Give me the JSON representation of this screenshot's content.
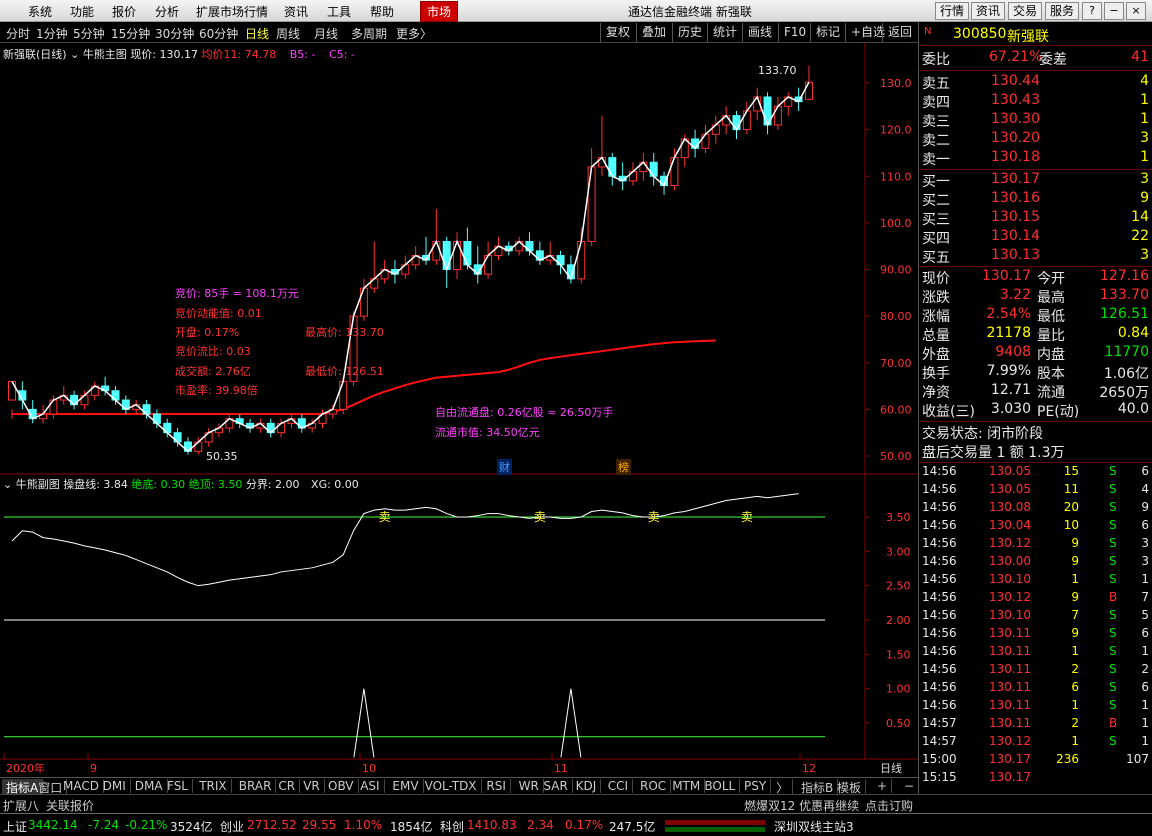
{
  "menu": {
    "items": [
      "系统",
      "功能",
      "报价",
      "分析",
      "扩展市场行情",
      "资讯",
      "工具",
      "帮助"
    ],
    "active": "市场",
    "title": "通达信金融终端 新强联",
    "right_buttons": [
      "行情",
      "资讯",
      "交易",
      "服务"
    ]
  },
  "periods": [
    "分时",
    "1分钟",
    "5分钟",
    "15分钟",
    "30分钟",
    "60分钟",
    "日线",
    "周线",
    "月线",
    "多周期",
    "更多〉"
  ],
  "selected_period": "日线",
  "tools": [
    "复权",
    "叠加",
    "历史",
    "统计",
    "画线",
    "F10",
    "标记",
    "+自选",
    "返回"
  ],
  "main_info": {
    "name": "新强联(日线)",
    "indicator": "牛熊主图",
    "price_label": "现价: 130.17",
    "ma_label": "均价11: 74.78",
    "b5": "B5: -",
    "c5": "C5: -"
  },
  "price_axis": [
    "130.0",
    "120.0",
    "110.0",
    "100.0",
    "90.00",
    "80.00",
    "70.00",
    "60.00",
    "50.00"
  ],
  "high_mark": "133.70",
  "low_mark": "50.35",
  "annotations": {
    "bid_price": "竞价: 85手 = 108.1万元",
    "bid_power": "竞价动能值: 0.01",
    "open": "开盘: 0.17%",
    "bid_ratio": "竞价流比: 0.03",
    "turnover": "成交额: 2.76亿",
    "pe": "市盈率: 39.98倍",
    "high": "最高价: 133.70",
    "low": "最低价: 126.51",
    "free_float": "自由流通盘: 0.26亿股 ≈ 26.50万手",
    "float_cap": "流通市值: 34.50亿元"
  },
  "markers": {
    "cai": "财",
    "bang": "榜"
  },
  "sub_info": {
    "indicator": "牛熊副图",
    "line_label": "操盘线: 3.84",
    "bottom_label": "绝底: 0.30",
    "top_label": "绝顶: 3.50",
    "divide_label": "分界: 2.00",
    "xg_label": "XG: 0.00"
  },
  "sub_axis": [
    "3.50",
    "3.00",
    "2.50",
    "2.00",
    "1.50",
    "1.00",
    "0.50"
  ],
  "sell_label": "卖",
  "x_axis": {
    "labels": [
      "2020年",
      "9",
      "10",
      "11",
      "12"
    ],
    "period": "日线"
  },
  "indicator_tabs": [
    "指标A",
    "窗口",
    "MACD",
    "DMI",
    "DMA",
    "FSL",
    "TRIX",
    "BRAR",
    "CR",
    "VR",
    "OBV",
    "ASI",
    "EMV",
    "VOL-TDX",
    "RSI",
    "WR",
    "SAR",
    "KDJ",
    "CCI",
    "ROC",
    "MTM",
    "BOLL",
    "PSY",
    "〉"
  ],
  "indicator_right": [
    "指标B",
    "模板",
    "+",
    "−"
  ],
  "status": {
    "left": [
      "扩展八",
      "关联报价"
    ],
    "ad": "燃爆双12 优惠再继续",
    "order": "点击订购"
  },
  "index_bar": {
    "sh_name": "上证",
    "sh_val": "3442.14",
    "sh_chg": "-7.24",
    "sh_pct": "-0.21%",
    "sh_amt": "3524亿",
    "cy_name": "创业",
    "cy_val": "2712.52",
    "cy_chg": "29.55",
    "cy_pct": "1.10%",
    "cy_amt": "1854亿",
    "kc_name": "科创",
    "kc_val": "1410.83",
    "kc_chg": "2.34",
    "kc_pct": "0.17%",
    "kc_amt": "247.5亿",
    "server": "深圳双线主站3"
  },
  "quote": {
    "code": "300850",
    "name": "新强联",
    "weibi_label": "委比",
    "weibi": "67.21%",
    "weicha_label": "委差",
    "weicha": "41",
    "asks": [
      {
        "label": "卖五",
        "price": "130.44",
        "vol": "4"
      },
      {
        "label": "卖四",
        "price": "130.43",
        "vol": "1"
      },
      {
        "label": "卖三",
        "price": "130.30",
        "vol": "1"
      },
      {
        "label": "卖二",
        "price": "130.20",
        "vol": "3"
      },
      {
        "label": "卖一",
        "price": "130.18",
        "vol": "1"
      }
    ],
    "bids": [
      {
        "label": "买一",
        "price": "130.17",
        "vol": "3"
      },
      {
        "label": "买二",
        "price": "130.16",
        "vol": "9"
      },
      {
        "label": "买三",
        "price": "130.15",
        "vol": "14"
      },
      {
        "label": "买四",
        "price": "130.14",
        "vol": "22"
      },
      {
        "label": "买五",
        "price": "130.13",
        "vol": "3"
      }
    ],
    "stats": [
      [
        "现价",
        "130.17",
        "今开",
        "127.16"
      ],
      [
        "涨跌",
        "3.22",
        "最高",
        "133.70"
      ],
      [
        "涨幅",
        "2.54%",
        "最低",
        "126.51"
      ],
      [
        "总量",
        "21178",
        "量比",
        "0.84"
      ],
      [
        "外盘",
        "9408",
        "内盘",
        "11770"
      ],
      [
        "换手",
        "7.99%",
        "股本",
        "1.06亿"
      ],
      [
        "净资",
        "12.71",
        "流通",
        "2650万"
      ],
      [
        "收益(三)",
        "3.030",
        "PE(动)",
        "40.0"
      ]
    ],
    "trade_status": "交易状态: 闭市阶段",
    "after_hours": "盘后交易量 1 额 1.3万"
  },
  "ticks": [
    [
      "14:56",
      "130.05",
      "15",
      "S",
      "6"
    ],
    [
      "14:56",
      "130.05",
      "11",
      "S",
      "4"
    ],
    [
      "14:56",
      "130.08",
      "20",
      "S",
      "9"
    ],
    [
      "14:56",
      "130.04",
      "10",
      "S",
      "6"
    ],
    [
      "14:56",
      "130.12",
      "9",
      "S",
      "3"
    ],
    [
      "14:56",
      "130.00",
      "9",
      "S",
      "3"
    ],
    [
      "14:56",
      "130.10",
      "1",
      "S",
      "1"
    ],
    [
      "14:56",
      "130.12",
      "9",
      "B",
      "7"
    ],
    [
      "14:56",
      "130.10",
      "7",
      "S",
      "5"
    ],
    [
      "14:56",
      "130.11",
      "9",
      "S",
      "6"
    ],
    [
      "14:56",
      "130.11",
      "1",
      "S",
      "1"
    ],
    [
      "14:56",
      "130.11",
      "2",
      "S",
      "2"
    ],
    [
      "14:56",
      "130.11",
      "6",
      "S",
      "6"
    ],
    [
      "14:56",
      "130.11",
      "1",
      "S",
      "1"
    ],
    [
      "14:57",
      "130.11",
      "2",
      "B",
      "1"
    ],
    [
      "14:57",
      "130.12",
      "1",
      "S",
      "1"
    ],
    [
      "15:00",
      "130.17",
      "236",
      "",
      "107"
    ],
    [
      "15:15",
      "130.17",
      "",
      "",
      ""
    ]
  ],
  "chart_data": {
    "type": "candlestick",
    "title": "新强联(日线)",
    "y_range": [
      48,
      136
    ],
    "candles": [
      [
        62,
        66,
        60,
        58
      ],
      [
        64,
        62,
        66,
        60
      ],
      [
        60,
        58,
        62,
        57
      ],
      [
        58,
        59,
        61,
        57
      ],
      [
        59,
        62,
        63,
        58
      ],
      [
        62,
        63,
        65,
        61
      ],
      [
        63,
        61,
        64,
        60
      ],
      [
        61,
        63,
        64,
        60
      ],
      [
        63,
        65,
        66,
        62
      ],
      [
        65,
        64,
        67,
        63
      ],
      [
        64,
        62,
        65,
        61
      ],
      [
        62,
        60,
        63,
        59
      ],
      [
        60,
        61,
        62,
        59
      ],
      [
        61,
        59,
        62,
        58
      ],
      [
        59,
        57,
        60,
        56
      ],
      [
        57,
        55,
        58,
        54
      ],
      [
        55,
        53,
        56,
        52
      ],
      [
        53,
        51,
        54,
        50.35
      ],
      [
        51,
        53,
        54,
        50.35
      ],
      [
        53,
        55,
        56,
        52
      ],
      [
        55,
        56,
        57,
        54
      ],
      [
        56,
        58,
        59,
        55
      ],
      [
        58,
        57,
        59,
        56
      ],
      [
        57,
        56,
        58,
        55
      ],
      [
        56,
        57,
        58,
        55
      ],
      [
        57,
        55,
        58,
        54
      ],
      [
        55,
        57,
        58,
        54
      ],
      [
        57,
        58,
        59,
        56
      ],
      [
        58,
        56,
        59,
        55
      ],
      [
        56,
        57,
        58,
        55
      ],
      [
        57,
        59,
        60,
        56
      ],
      [
        59,
        60,
        61,
        58
      ],
      [
        60,
        66,
        67,
        59
      ],
      [
        66,
        80,
        81,
        65
      ],
      [
        80,
        86,
        88,
        79
      ],
      [
        86,
        88,
        96,
        85
      ],
      [
        88,
        90,
        92,
        87
      ],
      [
        90,
        89,
        92,
        87
      ],
      [
        89,
        91,
        93,
        88
      ],
      [
        91,
        93,
        95,
        90
      ],
      [
        93,
        92,
        97,
        91
      ],
      [
        92,
        96,
        103,
        91
      ],
      [
        96,
        90,
        97,
        86
      ],
      [
        90,
        96,
        98,
        88
      ],
      [
        96,
        91,
        99,
        90
      ],
      [
        91,
        89,
        95,
        87
      ],
      [
        89,
        93,
        96,
        88
      ],
      [
        93,
        95,
        97,
        92
      ],
      [
        95,
        94,
        96,
        93
      ],
      [
        94,
        96,
        97,
        93
      ],
      [
        96,
        94,
        98,
        93
      ],
      [
        94,
        92,
        96,
        91
      ],
      [
        92,
        93,
        96,
        91
      ],
      [
        93,
        91,
        94,
        89
      ],
      [
        91,
        88,
        93,
        87
      ],
      [
        88,
        96,
        99,
        87
      ],
      [
        96,
        112,
        116,
        95
      ],
      [
        112,
        114,
        123,
        110
      ],
      [
        114,
        110,
        115,
        108
      ],
      [
        110,
        109,
        113,
        107
      ],
      [
        109,
        111,
        113,
        108
      ],
      [
        111,
        113,
        115,
        109
      ],
      [
        113,
        110,
        115,
        108
      ],
      [
        110,
        108,
        111,
        106
      ],
      [
        108,
        114,
        116,
        107
      ],
      [
        114,
        118,
        119,
        112
      ],
      [
        118,
        116,
        120,
        114
      ],
      [
        116,
        119,
        121,
        115
      ],
      [
        119,
        121,
        123,
        117
      ],
      [
        121,
        123,
        125,
        119
      ],
      [
        123,
        120,
        124,
        118
      ],
      [
        120,
        124,
        126,
        119
      ],
      [
        124,
        127,
        129,
        122
      ],
      [
        127,
        121,
        128,
        119
      ],
      [
        121,
        125,
        127,
        120
      ],
      [
        125,
        127,
        128,
        123
      ],
      [
        127,
        126,
        129,
        124
      ],
      [
        126.5,
        130.17,
        133.7,
        126.51
      ]
    ],
    "ma_values": [
      59,
      59,
      59,
      59,
      59,
      59,
      59,
      59,
      59,
      59,
      59,
      59,
      59,
      59,
      59,
      59,
      59,
      59,
      59,
      59,
      59,
      59,
      59,
      59,
      59,
      59,
      59,
      59,
      59,
      59,
      59,
      59.5,
      60,
      61,
      62,
      63,
      63.8,
      64.5,
      65.2,
      65.8,
      66.3,
      66.8,
      67,
      67.2,
      67.4,
      67.6,
      67.8,
      68,
      68.5,
      69.2,
      70,
      70.6,
      71,
      71.3,
      71.6,
      71.9,
      72.2,
      72.5,
      72.8,
      73.1,
      73.4,
      73.7,
      74,
      74.2,
      74.4,
      74.5,
      74.6,
      74.7,
      74.78
    ],
    "sub_line": [
      3.15,
      3.3,
      3.28,
      3.2,
      3.18,
      3.15,
      3.12,
      3.08,
      3.05,
      3.02,
      2.98,
      2.94,
      2.88,
      2.82,
      2.76,
      2.7,
      2.62,
      2.55,
      2.5,
      2.52,
      2.55,
      2.58,
      2.6,
      2.62,
      2.64,
      2.66,
      2.7,
      2.72,
      2.74,
      2.76,
      2.8,
      2.84,
      2.95,
      3.3,
      3.55,
      3.6,
      3.62,
      3.6,
      3.6,
      3.62,
      3.64,
      3.62,
      3.55,
      3.5,
      3.5,
      3.52,
      3.55,
      3.55,
      3.52,
      3.5,
      3.48,
      3.5,
      3.5,
      3.48,
      3.48,
      3.5,
      3.58,
      3.6,
      3.58,
      3.56,
      3.52,
      3.5,
      3.5,
      3.52,
      3.56,
      3.58,
      3.62,
      3.66,
      3.7,
      3.74,
      3.76,
      3.78,
      3.8,
      3.78,
      3.8,
      3.82,
      3.84
    ],
    "xg_peaks": [
      {
        "index": 34,
        "value": 1.0
      },
      {
        "index": 54,
        "value": 1.0
      }
    ],
    "top_line": 3.5,
    "divide_line": 2.0,
    "bottom_line": 0.3
  }
}
